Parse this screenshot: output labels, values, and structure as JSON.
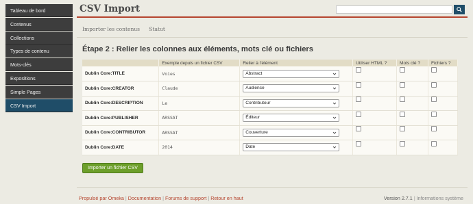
{
  "sidebar": {
    "items": [
      {
        "label": "Tableau de bord"
      },
      {
        "label": "Contenus"
      },
      {
        "label": "Collections"
      },
      {
        "label": "Types de contenu"
      },
      {
        "label": "Mots-clés"
      },
      {
        "label": "Expositions"
      },
      {
        "label": "Simple Pages"
      },
      {
        "label": "CSV Import",
        "active": true
      }
    ]
  },
  "header": {
    "title": "CSV Import",
    "search": {
      "value": "",
      "icon": "search-icon"
    }
  },
  "subnav": {
    "items": [
      "Importer les contenus",
      "Statut"
    ]
  },
  "main": {
    "step_title": "Étape 2 : Relier les colonnes aux éléments, mots clé ou fichiers",
    "table": {
      "headers": [
        "",
        "Exemple depuis un fichier CSV",
        "Relier à l'élément",
        "Utiliser HTML ?",
        "Mots clé ?",
        "Fichiers ?"
      ],
      "rows": [
        {
          "element": "Dublin Core:TITLE",
          "example": "Voies",
          "mapping": "Abstract"
        },
        {
          "element": "Dublin Core:CREATOR",
          "example": "Claude",
          "mapping": "Audience"
        },
        {
          "element": "Dublin Core:DESCRIPTION",
          "example": "Le",
          "mapping": "Contributeur"
        },
        {
          "element": "Dublin Core:PUBLISHER",
          "example": "ARSSAT",
          "mapping": "Éditeur"
        },
        {
          "element": "Dublin Core:CONTRIBUTOR",
          "example": "ARSSAT",
          "mapping": "Couverture"
        },
        {
          "element": "Dublin Core:DATE",
          "example": "2014",
          "mapping": "Date"
        }
      ]
    },
    "import_button": "Importer un fichier CSV"
  },
  "footer": {
    "powered": "Propulsé par Omeka",
    "documentation": "Documentation",
    "support": "Forums de support",
    "back_to_top": "Retour en haut",
    "version": "Version 2.7.1",
    "system_info": "Informations système"
  },
  "colors": {
    "accent": "#b5442e",
    "sidebar_bg": "#3d3d3d",
    "sidebar_active": "#1f4d68",
    "button_green": "#6d9f2b"
  }
}
